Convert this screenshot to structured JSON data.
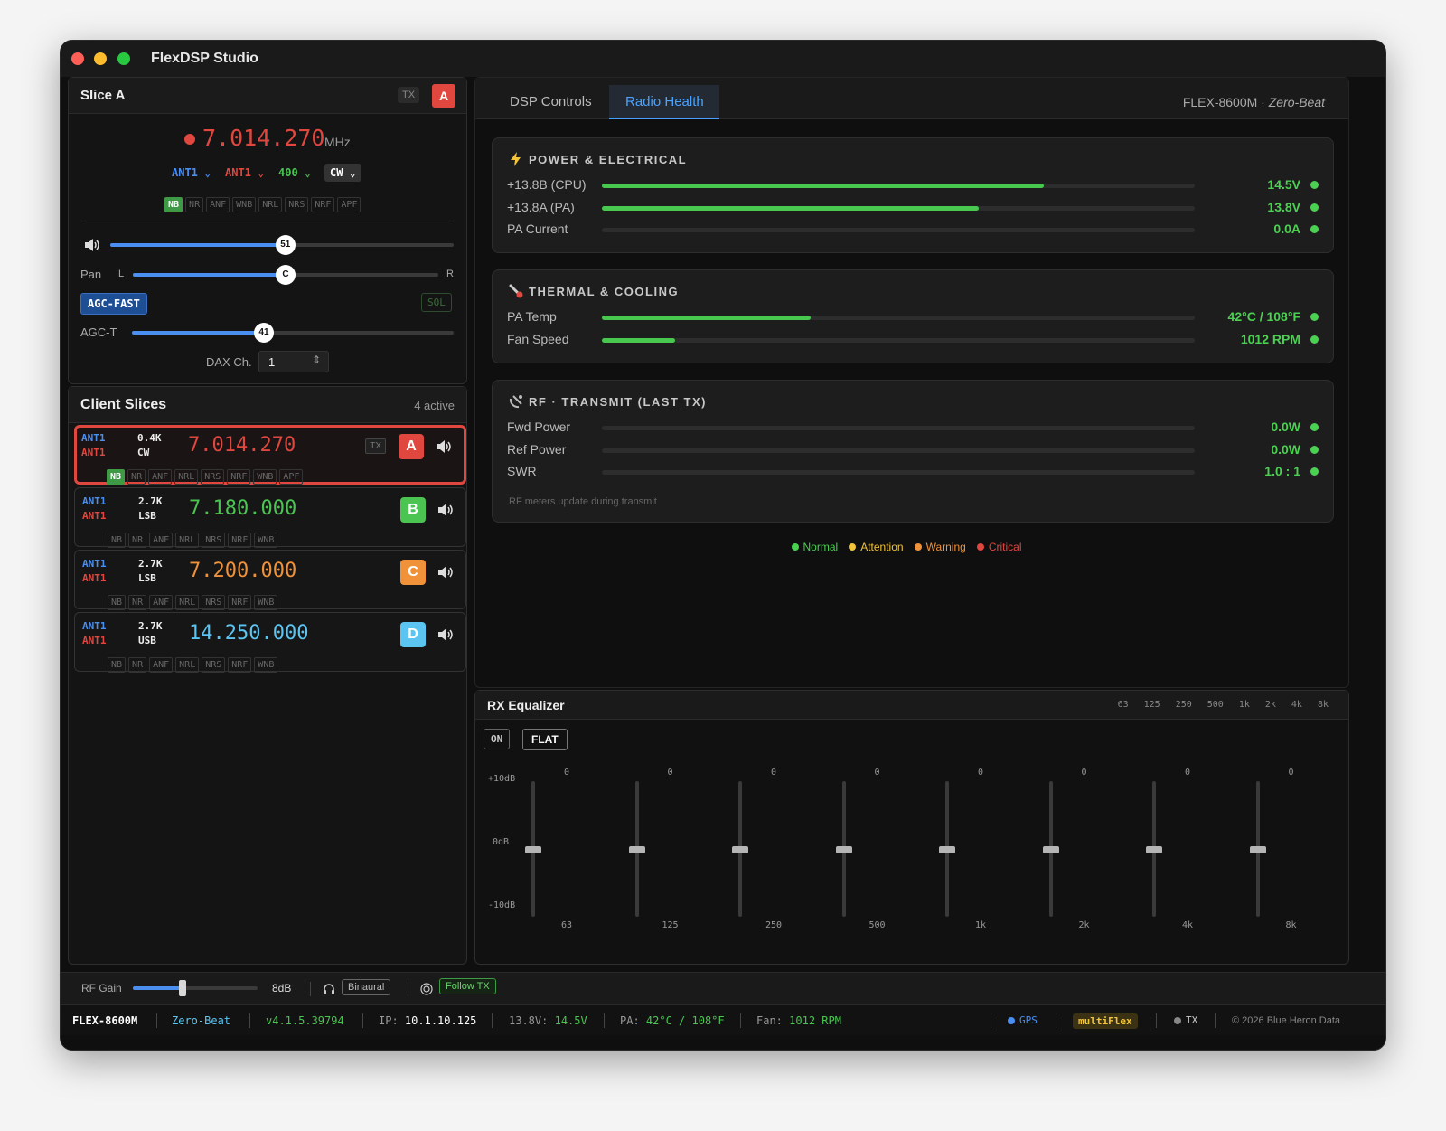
{
  "window": {
    "title": "FlexDSP Studio"
  },
  "slice_panel": {
    "title": "Slice A",
    "tx_label": "TX",
    "letter": "A",
    "frequency": "7.014.270",
    "unit": "MHz",
    "ant_rx": "ANT1",
    "ant_tx": "ANT1",
    "bandwidth": "400",
    "mode": "CW",
    "dsp_tags": [
      "NB",
      "NR",
      "ANF",
      "WNB",
      "NRL",
      "NRS",
      "NRF",
      "APF"
    ],
    "active_tag": "NB",
    "volume": {
      "value": 51,
      "fraction": 0.51
    },
    "pan": {
      "label": "Pan",
      "left": "L",
      "right": "R",
      "knob": "C",
      "fraction": 0.5
    },
    "agc_mode": "AGC-FAST",
    "sql_label": "SQL",
    "agc_t": {
      "label": "AGC-T",
      "value": 41,
      "fraction": 0.41
    },
    "dax": {
      "label": "DAX Ch.",
      "value": "1"
    }
  },
  "client_slices": {
    "title": "Client Slices",
    "count": "4 active",
    "items": [
      {
        "ant1": "ANT1",
        "ant2": "ANT1",
        "bw": "0.4K",
        "mode": "CW",
        "freq": "7.014.270",
        "letter": "A",
        "color": "#e0473f",
        "tx": "TX",
        "tags": [
          "NB",
          "NR",
          "ANF",
          "NRL",
          "NRS",
          "NRF",
          "WNB",
          "APF"
        ],
        "active": "NB"
      },
      {
        "ant1": "ANT1",
        "ant2": "ANT1",
        "bw": "2.7K",
        "mode": "LSB",
        "freq": "7.180.000",
        "letter": "B",
        "color": "#4bc452",
        "tags": [
          "NB",
          "NR",
          "ANF",
          "NRL",
          "NRS",
          "NRF",
          "WNB"
        ]
      },
      {
        "ant1": "ANT1",
        "ant2": "ANT1",
        "bw": "2.7K",
        "mode": "LSB",
        "freq": "7.200.000",
        "letter": "C",
        "color": "#f0923a",
        "tags": [
          "NB",
          "NR",
          "ANF",
          "NRL",
          "NRS",
          "NRF",
          "WNB"
        ]
      },
      {
        "ant1": "ANT1",
        "ant2": "ANT1",
        "bw": "2.7K",
        "mode": "USB",
        "freq": "14.250.000",
        "letter": "D",
        "color": "#5cc4f0",
        "tags": [
          "NB",
          "NR",
          "ANF",
          "NRL",
          "NRS",
          "NRF",
          "WNB"
        ]
      }
    ]
  },
  "tabs": [
    {
      "label": "DSP Controls"
    },
    {
      "label": "Radio Health"
    }
  ],
  "device": {
    "model": "FLEX-8600M ·",
    "nickname": "Zero-Beat"
  },
  "health": {
    "power": {
      "title": "POWER & ELECTRICAL",
      "icon": "lightning-icon",
      "rows": [
        {
          "label": "+13.8B (CPU)",
          "value": "14.5V",
          "fraction": 0.745
        },
        {
          "label": "+13.8A (PA)",
          "value": "13.8V",
          "fraction": 0.635
        },
        {
          "label": "PA Current",
          "value": "0.0A",
          "fraction": 0
        }
      ]
    },
    "thermal": {
      "title": "THERMAL & COOLING",
      "icon": "thermometer-icon",
      "rows": [
        {
          "label": "PA Temp",
          "value": "42°C / 108°F",
          "fraction": 0.352
        },
        {
          "label": "Fan Speed",
          "value": "1012 RPM",
          "fraction": 0.124
        }
      ]
    },
    "rf": {
      "title": "RF · TRANSMIT (LAST TX)",
      "icon": "satellite-icon",
      "rows": [
        {
          "label": "Fwd Power",
          "value": "0.0W",
          "fraction": 0
        },
        {
          "label": "Ref Power",
          "value": "0.0W",
          "fraction": 0
        },
        {
          "label": "SWR",
          "value": "1.0 : 1",
          "fraction": 0
        }
      ],
      "note": "RF meters update during transmit"
    },
    "legend": [
      {
        "label": "Normal",
        "color": "#4bd152"
      },
      {
        "label": "Attention",
        "color": "#f2c53a"
      },
      {
        "label": "Warning",
        "color": "#f0923a"
      },
      {
        "label": "Critical",
        "color": "#e0473f"
      }
    ]
  },
  "equalizer": {
    "title": "RX Equalizer",
    "on_label": "ON",
    "flat_label": "FLAT",
    "scale": {
      "top": "+10dB",
      "mid": "0dB",
      "bottom": "-10dB"
    },
    "bands": [
      {
        "f": "63",
        "v": "0"
      },
      {
        "f": "125",
        "v": "0"
      },
      {
        "f": "250",
        "v": "0"
      },
      {
        "f": "500",
        "v": "0"
      },
      {
        "f": "1k",
        "v": "0"
      },
      {
        "f": "2k",
        "v": "0"
      },
      {
        "f": "4k",
        "v": "0"
      },
      {
        "f": "8k",
        "v": "0"
      }
    ]
  },
  "bottom_bar": {
    "rf_gain_label": "RF Gain",
    "rf_gain_value": "8dB",
    "rf_gain_fraction": 0.4,
    "binaural": "Binaural",
    "follow_tx": "Follow TX"
  },
  "status": {
    "model": "FLEX-8600M",
    "nickname": "Zero-Beat",
    "version": "v4.1.5.39794",
    "ip_label": "IP:",
    "ip": "10.1.10.125",
    "v_label": "13.8V:",
    "v": "14.5V",
    "pa_label": "PA:",
    "pa": "42°C / 108°F",
    "fan_label": "Fan:",
    "fan": "1012 RPM",
    "gps": "GPS",
    "multiflex": "multiFlex",
    "tx": "TX",
    "copyright": "© 2026 Blue Heron Data"
  }
}
